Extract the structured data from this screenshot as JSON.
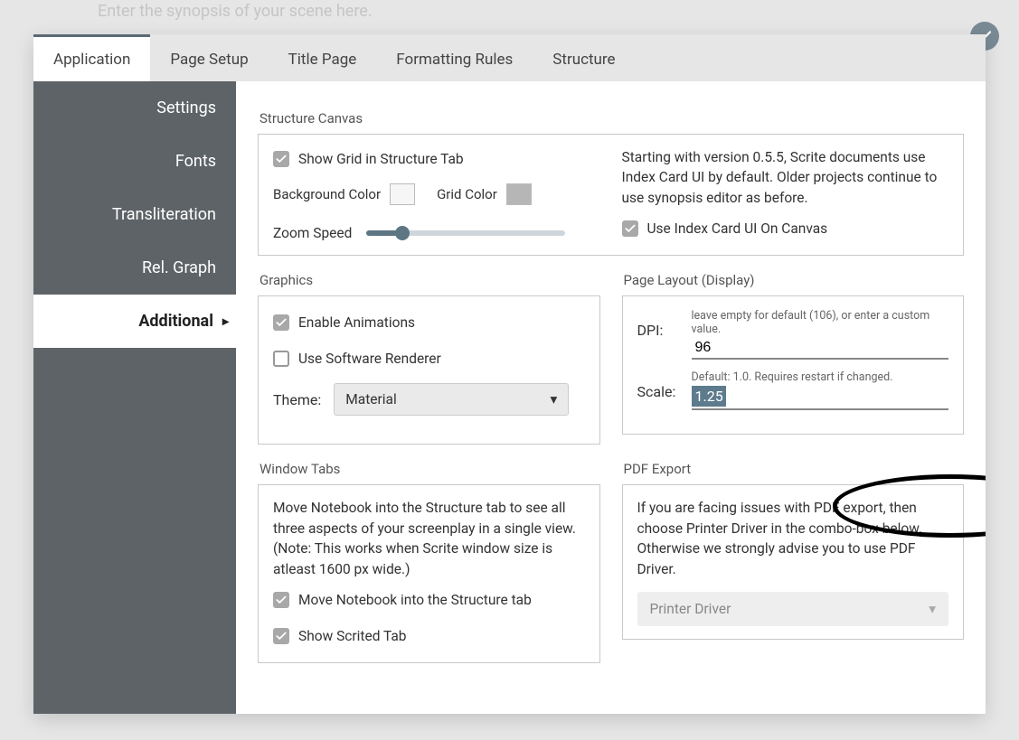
{
  "bgHint": "Enter the synopsis of your scene here.",
  "topTabs": [
    "Application",
    "Page Setup",
    "Title Page",
    "Formatting Rules",
    "Structure"
  ],
  "sidebar": {
    "items": [
      "Settings",
      "Fonts",
      "Transliteration",
      "Rel. Graph",
      "Additional"
    ]
  },
  "structureCanvas": {
    "title": "Structure Canvas",
    "showGrid": "Show Grid in Structure Tab",
    "bgColorLabel": "Background Color",
    "gridColorLabel": "Grid Color",
    "bgColor": "#f6f6f6",
    "gridColor": "#b6b6b6",
    "zoomLabel": "Zoom Speed",
    "note": "Starting with version 0.5.5, Scrite documents use Index Card UI by default. Older projects continue to use synopsis editor as before.",
    "indexCard": "Use Index Card UI On Canvas"
  },
  "graphics": {
    "title": "Graphics",
    "animations": "Enable Animations",
    "software": "Use Software Renderer",
    "themeLabel": "Theme:",
    "themeValue": "Material"
  },
  "display": {
    "title": "Page Layout (Display)",
    "dpiLabel": "DPI:",
    "dpiHint": "leave empty for default (106), or enter a custom value.",
    "dpiValue": "96",
    "scaleLabel": "Scale:",
    "scaleHint": "Default: 1.0. Requires restart if changed.",
    "scaleValue": "1.25"
  },
  "windowTabs": {
    "title": "Window Tabs",
    "note": "Move Notebook into the Structure tab to see all three aspects of your screenplay in a single view. (Note: This works when Scrite window size is atleast 1600 px wide.)",
    "moveNotebook": "Move Notebook into the Structure tab",
    "scrited": "Show Scrited Tab"
  },
  "pdf": {
    "title": "PDF Export",
    "note": "If you are facing issues with PDF export, then choose Printer Driver in the combo-box below. Otherwise we strongly advise you to use PDF Driver.",
    "driver": "Printer Driver"
  }
}
